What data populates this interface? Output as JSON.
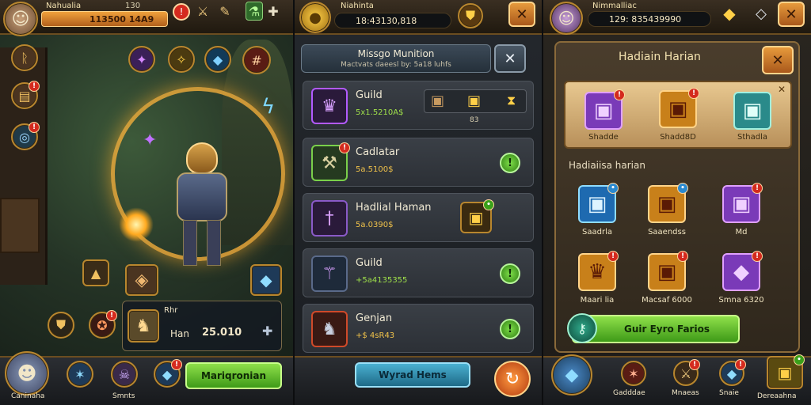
{
  "left": {
    "player_name": "Nahualia",
    "level": "130",
    "exp_text": "113500 14A9",
    "skill_icons": [
      "rune-icon",
      "purple-crystal-icon",
      "gold-rune-icon",
      "blue-rune-icon",
      "hash-rune-icon"
    ],
    "equip_name": "Rhr",
    "equip_sub": "Han",
    "equip_value": "25.010",
    "bottom_nav": [
      {
        "label": "Caninaha"
      },
      {
        "label": ""
      },
      {
        "label": "Smnts"
      },
      {
        "label": ""
      }
    ],
    "main_button": "Mariqronian"
  },
  "middle": {
    "resource_text": "Niahinta",
    "resource_value": "18:43130,818",
    "dialog_title": "Missgo Munition",
    "dialog_subtitle": "Mactvats daeesl by: 5a18 luhfs",
    "items": [
      {
        "title": "Guild",
        "sub": "5x1.5210A$",
        "extra": "83"
      },
      {
        "title": "Cadlatar",
        "sub": "5a.5100$"
      },
      {
        "title": "Hadlial Haman",
        "sub": "5a.0390$"
      },
      {
        "title": "Guild",
        "sub": "+5a4135355"
      },
      {
        "title": "Genjan",
        "sub": "+$ 4sR43"
      }
    ],
    "bottom_button": "Wyrad Hems"
  },
  "right": {
    "player_name": "Nimmalliac",
    "resource_value": "129: 835439990",
    "dialog_title": "Hadiain Harian",
    "featured": [
      {
        "label": "Shadde"
      },
      {
        "label": "Shadd8D"
      },
      {
        "label": "Sthadla"
      }
    ],
    "section_title": "Hadiaiisa harian",
    "grid": [
      {
        "label": "Saadrla"
      },
      {
        "label": "Saaendss"
      },
      {
        "label": "Md"
      },
      {
        "label": "Maari lia"
      },
      {
        "label": "Macsaf 6000"
      },
      {
        "label": "Smna 6320"
      }
    ],
    "action_button": "Guir Eyro Farios",
    "bottom_nav": [
      {
        "label": ""
      },
      {
        "label": "Gadddae"
      },
      {
        "label": "Mnaeas"
      },
      {
        "label": "Snaie"
      },
      {
        "label": "Dereaahna"
      }
    ]
  }
}
